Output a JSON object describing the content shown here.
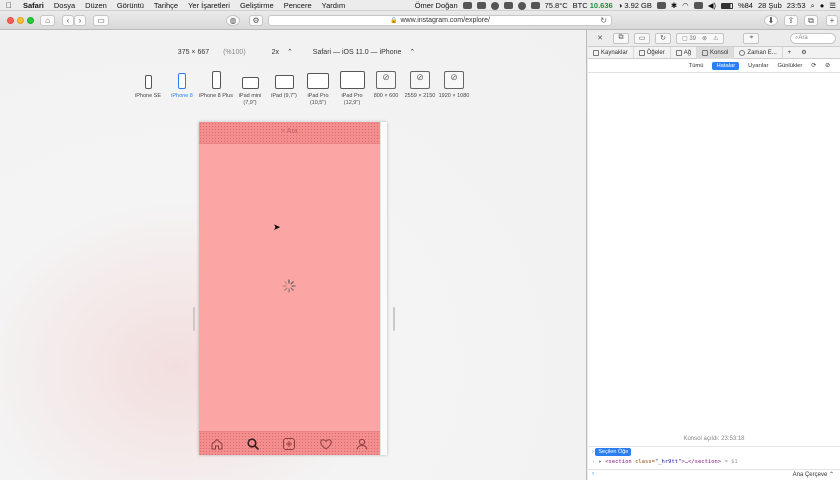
{
  "menubar": {
    "apple_icon": "apple-icon",
    "menus": [
      "Safari",
      "Dosya",
      "Düzen",
      "Görüntü",
      "Tarihçe",
      "Yer İşaretleri",
      "Geliştirme",
      "Pencere",
      "Yardım"
    ],
    "user": "Ömer Doğan",
    "temperature": "75.8°C",
    "btc_label": "BTC",
    "btc_value": "10.636",
    "memory": "3.92 GB",
    "battery": "%84",
    "date": "28 Şub",
    "time": "23:53"
  },
  "toolbar": {
    "url": "www.instagram.com/explore/"
  },
  "responsive": {
    "size": "375 × 667",
    "zoom": "(%100)",
    "scale": "2x",
    "user_agent": "Safari — iOS 11.0 — iPhone",
    "devices": [
      {
        "label": "iPhone SE"
      },
      {
        "label": "iPhone 8"
      },
      {
        "label": "iPhone 8 Plus"
      },
      {
        "label": "iPad mini (7,9\")"
      },
      {
        "label": "iPad (9,7\")"
      },
      {
        "label": "iPad Pro (10,5\")"
      },
      {
        "label": "iPad Pro (12,9\")"
      },
      {
        "label": "800 × 600"
      },
      {
        "label": "2559 × 2150"
      },
      {
        "label": "1920 × 1080"
      }
    ],
    "selected_device": "iPhone 8"
  },
  "phone": {
    "search_placeholder": "Ara"
  },
  "inspector": {
    "count": "39",
    "tabs": [
      "Kaynaklar",
      "Öğeler",
      "Ağ",
      "Konsol",
      "Zaman E..."
    ],
    "active_tab": "Konsol",
    "filters": [
      "Tümü",
      "Hatalar",
      "Uyarılar",
      "Günlükler"
    ],
    "active_filter": "Hatalar",
    "search_placeholder": "Ara",
    "console_opened": "Konsol açıldı: 23:53:18",
    "selected_chip": "Seçilen Öğe",
    "code_tag_open": "<section",
    "code_attr": "class=",
    "code_value": "\"_hr9tt\"",
    "code_rest": ">…</section>",
    "code_ref": "= $1",
    "frame_select": "Ana Çerçeve"
  },
  "colors": {
    "accent": "#2a7ff5",
    "viewport_overlay": "#fca5a5"
  }
}
